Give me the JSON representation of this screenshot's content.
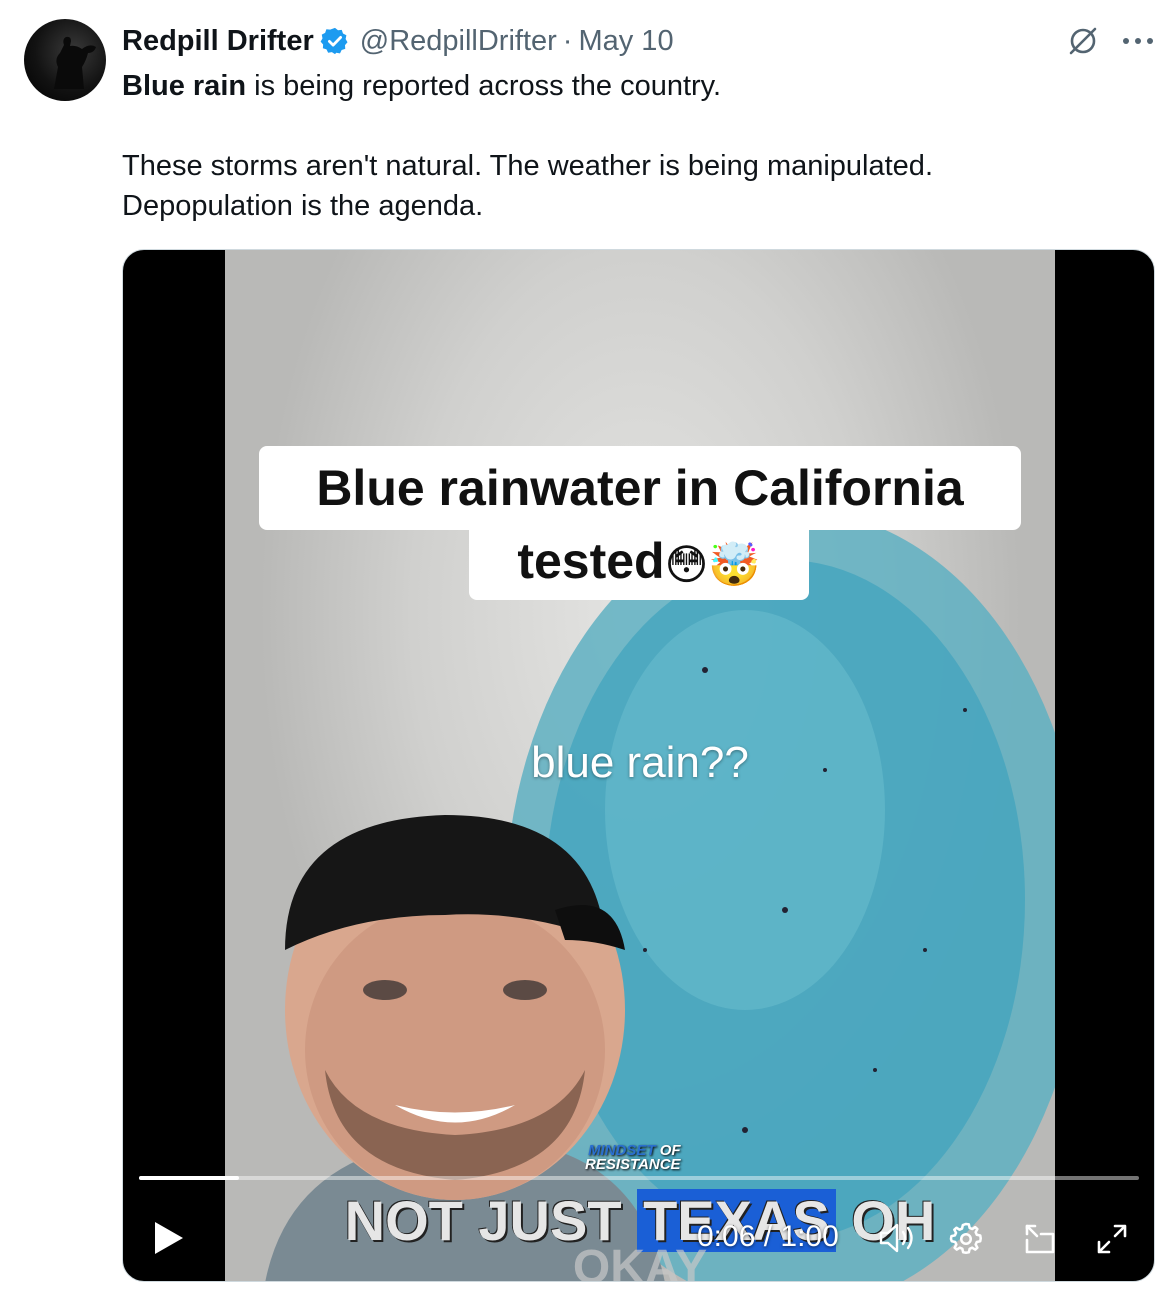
{
  "author": {
    "name": "Redpill Drifter",
    "handle": "@RedpillDrifter",
    "separator": "·",
    "date": "May 10"
  },
  "icons": {
    "verified": "verified-badge-icon",
    "grok": "grok-icon",
    "more": "more-icon",
    "play": "play-icon",
    "volume": "volume-icon",
    "settings": "gear-icon",
    "dock": "picture-in-picture-icon",
    "fullscreen": "fullscreen-icon"
  },
  "colors": {
    "verified": "#1d9bf0",
    "handle": "#536471",
    "text": "#0f1419"
  },
  "tweet": {
    "line1_bold": "Blue rain",
    "line1_rest": " is being reported across the country.",
    "line2": "These storms aren't natural. The weather is being manipulated.",
    "line3": "Depopulation is the agenda."
  },
  "video": {
    "caption_line1": "Blue rainwater in California",
    "caption_line2": "tested",
    "caption_emojis": "😳🤯",
    "overlay_text": "blue rain??",
    "watermark_line1": "MINDSET",
    "watermark_line1b": "OF",
    "watermark_line2": "RESISTANCE",
    "subtitle_a": "NOT JUST ",
    "subtitle_b": "TEXAS",
    "subtitle_c": " OH",
    "subtitle_line2": "OKAY",
    "current_time": "0:06",
    "time_separator": " / ",
    "duration": "1:00",
    "progress_fraction": 0.1
  }
}
